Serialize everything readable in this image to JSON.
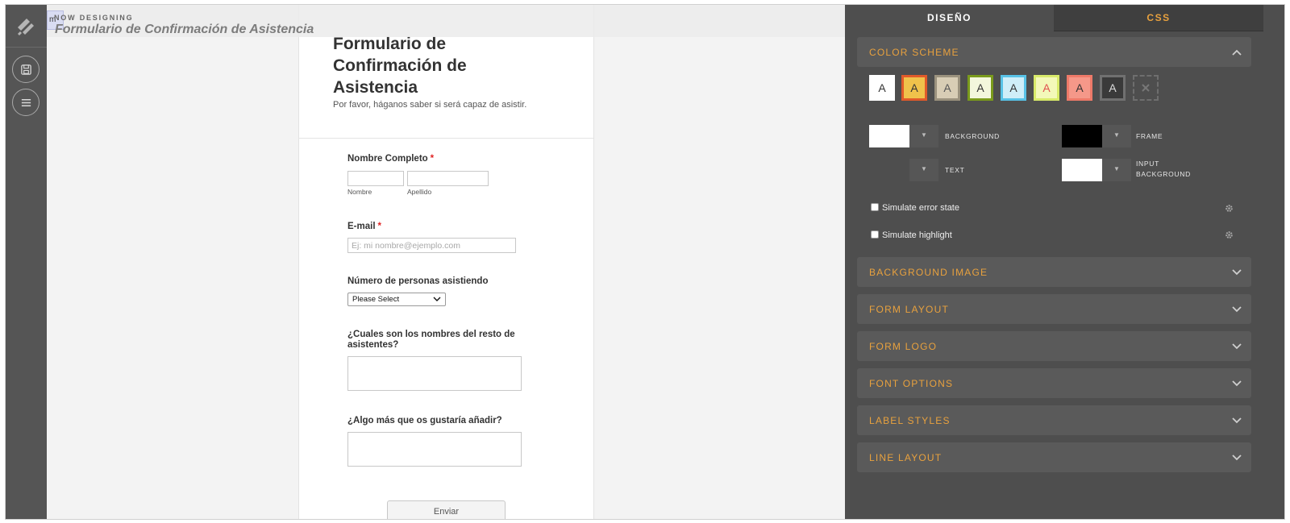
{
  "designer": {
    "now_designing_label": "NOW DESIGNING",
    "badge_letter": "m",
    "form_name": "Formulario de Confirmación de Asistencia"
  },
  "form": {
    "title": "Formulario de Confirmación de Asistencia",
    "subtitle": "Por favor, háganos saber si será capaz de asistir.",
    "full_name": {
      "label": "Nombre Completo",
      "required_mark": "*",
      "first_sublabel": "Nombre",
      "last_sublabel": "Apellido"
    },
    "email": {
      "label": "E-mail",
      "required_mark": "*",
      "placeholder": "Ej: mi nombre@ejemplo.com"
    },
    "guests": {
      "label": "Número de personas asistiendo",
      "selected": "Please Select"
    },
    "other_names": {
      "label": "¿Cuales son los nombres del resto de asistentes?"
    },
    "comments": {
      "label": "¿Algo más que os gustaría añadir?"
    },
    "submit_label": "Enviar"
  },
  "panel": {
    "tabs": [
      {
        "label": "DISEÑO"
      },
      {
        "label": "CSS"
      }
    ],
    "color_scheme": {
      "title": "COLOR SCHEME",
      "swatch_letter": "A",
      "swatches": [
        {
          "bg": "#ffffff",
          "border": "#ffffff",
          "text": "#333333"
        },
        {
          "bg": "#f0c24b",
          "border": "#e05a2a",
          "text": "#333333"
        },
        {
          "bg": "#d8cdb5",
          "border": "#9b927e",
          "text": "#555555"
        },
        {
          "bg": "#f3f7dc",
          "border": "#7a9a1c",
          "text": "#333333"
        },
        {
          "bg": "#cfeef8",
          "border": "#58c2e6",
          "text": "#333333"
        },
        {
          "bg": "#f3f8b9",
          "border": "#d8ea6a",
          "text": "#e05050"
        },
        {
          "bg": "#f59889",
          "border": "#ee7a69",
          "text": "#333333"
        },
        {
          "bg": "#3a3a3a",
          "border": "#707070",
          "text": "#dddddd"
        }
      ],
      "background_label": "BACKGROUND",
      "frame_label": "FRAME",
      "text_label": "TEXT",
      "input_background_label": "INPUT BACKGROUND",
      "background_color": "#ffffff",
      "frame_color": "#000000",
      "text_color": "#4e4e4e",
      "input_background_color": "#ffffff",
      "simulate_error": "Simulate error state",
      "simulate_highlight": "Simulate highlight"
    },
    "sections": [
      {
        "title": "BACKGROUND IMAGE"
      },
      {
        "title": "FORM LAYOUT"
      },
      {
        "title": "FORM LOGO"
      },
      {
        "title": "FONT OPTIONS"
      },
      {
        "title": "LABEL STYLES"
      },
      {
        "title": "LINE LAYOUT"
      }
    ]
  },
  "colors": {
    "accent": "#e8a13e",
    "panel_bg": "#4e4e4e",
    "rail_bg": "#555555"
  }
}
